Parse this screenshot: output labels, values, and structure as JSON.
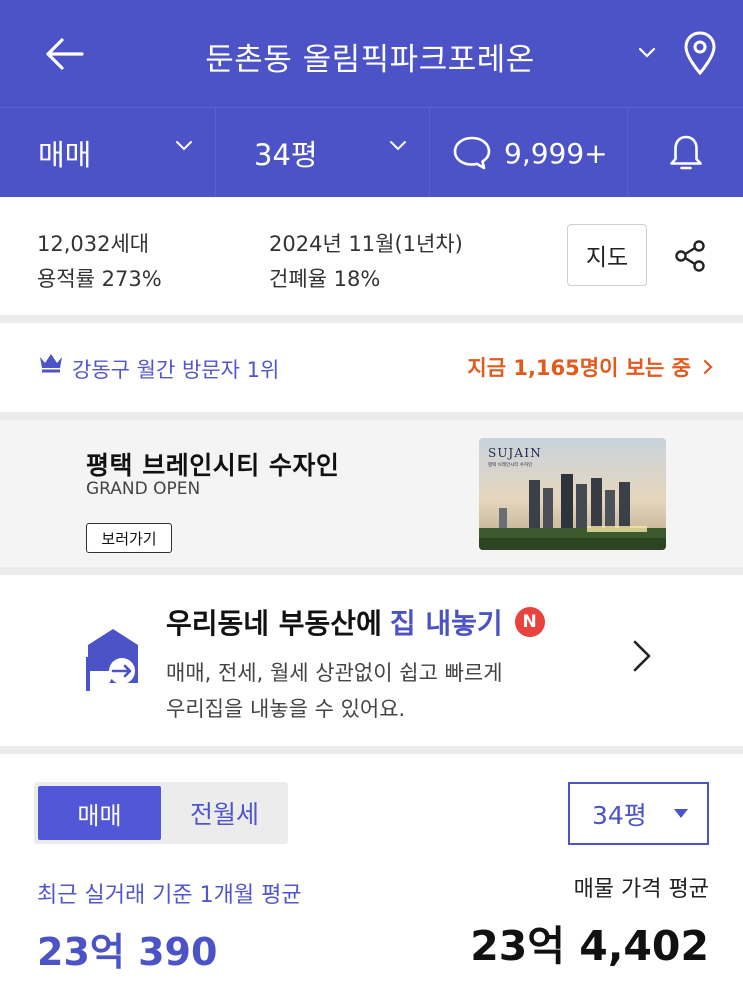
{
  "header": {
    "title": "둔촌동 올림픽파크포레온",
    "back_icon": "arrow-left-icon",
    "location_icon": "map-pin-icon"
  },
  "filters": {
    "deal_type": "매매",
    "size": "34평",
    "comment_count": "9,999+"
  },
  "info": {
    "households": "12,032세대",
    "floor_area_ratio": "용적률 273%",
    "completion": "2024년 11월(1년차)",
    "coverage_ratio": "건폐율 18%",
    "map_button": "지도"
  },
  "visitor": {
    "rank": "강동구 월간 방문자 1위",
    "viewing_now": "지금 1,165명이 보는 중"
  },
  "banner": {
    "title": "평택 브레인시티 수자인",
    "subtitle": "GRAND OPEN",
    "button": "보러가기",
    "brand": "SUJAIN",
    "brand_sub": "평택 브레인시티 수자인"
  },
  "listing_promo": {
    "title_prefix": "우리동네 부동산에",
    "title_highlight": "집 내놓기",
    "badge": "N",
    "desc_line1": "매매, 전세, 월세 상관없이 쉽고 빠르게",
    "desc_line2": "우리집을 내놓을 수 있어요."
  },
  "price": {
    "tabs": [
      "매매",
      "전월세"
    ],
    "size_select": "34평",
    "recent_label": "최근 실거래 기준 1개월 평균",
    "recent_value": "23억 390",
    "avg_label": "매물 가격 평균",
    "avg_value": "23억 4,402"
  },
  "colors": {
    "primary": "#4b53c6",
    "accent_orange": "#e25a1c",
    "badge_red": "#e8433c"
  }
}
